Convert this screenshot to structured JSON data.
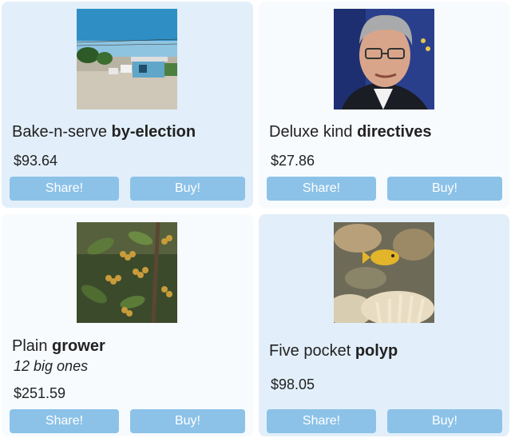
{
  "products": [
    {
      "adjective": "Bake-n-serve",
      "noun": "by-election",
      "subtitle": "",
      "price": "$93.64",
      "image_icon": "street-scene-photo",
      "share_label": "Share!",
      "buy_label": "Buy!"
    },
    {
      "adjective": "Deluxe kind",
      "noun": "directives",
      "subtitle": "",
      "price": "$27.86",
      "image_icon": "man-portrait-photo",
      "share_label": "Share!",
      "buy_label": "Buy!"
    },
    {
      "adjective": "Plain",
      "noun": "grower",
      "subtitle": "12 big ones",
      "price": "$251.59",
      "image_icon": "coffee-plant-photo",
      "share_label": "Share!",
      "buy_label": "Buy!"
    },
    {
      "adjective": "Five pocket",
      "noun": "polyp",
      "subtitle": "",
      "price": "$98.05",
      "image_icon": "coral-fish-photo",
      "share_label": "Share!",
      "buy_label": "Buy!"
    }
  ],
  "colors": {
    "button": "#8cc2e8",
    "card_highlight": "#e2effa",
    "card_plain": "#f7fbfe"
  }
}
